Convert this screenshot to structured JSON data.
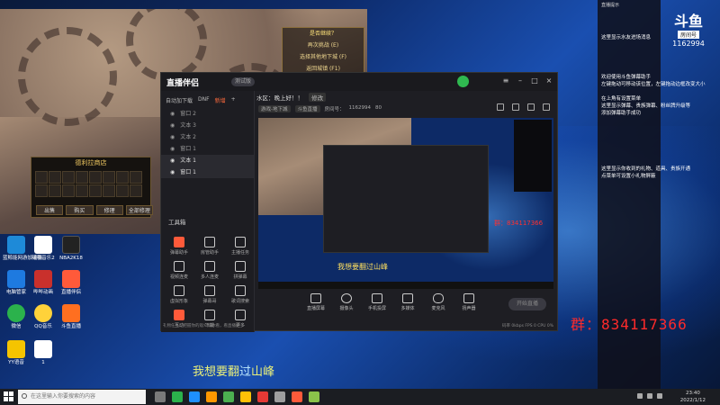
{
  "game": {
    "menu": [
      "是否继续？",
      "再次挑战 (E)",
      "选择其他地下城 (F)",
      "返回城镇 (F1)"
    ],
    "shop_title": "德利拉商店",
    "shop_buttons": [
      "出售",
      "购买",
      "修理",
      "全部修理"
    ]
  },
  "desktop_icons": [
    {
      "label": "蓝鲸能网游加速器",
      "color": "#1e8ad8"
    },
    {
      "label": "咕咕音乐2",
      "color": "#ffffff"
    },
    {
      "label": "NBA2K18",
      "color": "#222222"
    },
    {
      "label": "电脑管家",
      "color": "#1e7ae0"
    },
    {
      "label": "哔哔动画",
      "color": "#c9302c"
    },
    {
      "label": "直播伴侣",
      "color": "#ff5a3a"
    },
    {
      "label": "微信",
      "color": "#2bb24c"
    },
    {
      "label": "QQ音乐",
      "color": "#ffd23a"
    },
    {
      "label": "斗鱼直播",
      "color": "#ff6f20"
    },
    {
      "label": "YY语音",
      "color": "#f5c400"
    },
    {
      "label": "1",
      "color": "#ffffff"
    }
  ],
  "app": {
    "title": "直播伴侣",
    "badge": "测试版",
    "tabs": [
      "自动加下载",
      "DNF",
      "新增"
    ],
    "scenes": [
      "窗口 2",
      "文本 3",
      "文本 2",
      "窗口 1",
      "文本 1",
      "窗口 1"
    ],
    "tools_label": "工具箱",
    "tools": [
      "弹幕助手",
      "房管助手",
      "主播任务",
      "视频连麦",
      "多人连麦",
      "拼弹幕",
      "虚拟形象",
      "弹幕哥",
      "歌词搜索",
      "互动",
      "下载",
      "更多"
    ],
    "room_title": "水区：晚上好！！",
    "edit_label": "修改",
    "sub_tags": [
      "游戏-地下城",
      "斗鱼直播"
    ],
    "room_no_label": "房间号：",
    "room_no": "1162994",
    "fans": "80",
    "controls": [
      "直播屏幕",
      "摄像头",
      "手机投屏",
      "多媒体",
      "麦克风",
      "扬声器"
    ],
    "start_button": "开始直播",
    "status_left": "礼物任务，把握你的观众帮你看，看直播吧",
    "status_right": "码率 0kbps   FPS 0   CPU 0%"
  },
  "preview": {
    "contact": "群：834117366",
    "subtitle": "我想要翻过山峰"
  },
  "douyu": {
    "brand": "斗鱼",
    "room_label": "房间号",
    "room_number": "1162994",
    "panel_title": "直播提示",
    "messages": [
      "这里显示水友进场消息",
      "欢迎使用斗鱼弹幕助手",
      "左键拖动可移动该位置，左键拖动边框改变大小",
      "在上角有设置菜单",
      "这里显示弹幕、贵族弹幕、粉丝牌升级等",
      "添加弹幕助手成功",
      "这里显示你收到的礼物、道具、贵族开通",
      "点菜单可设置小礼物屏蔽"
    ]
  },
  "contact_overlay": "群：834117366",
  "subtitle": {
    "before": "我想要翻",
    "highlight": "过",
    "after": "山峰"
  },
  "taskbar": {
    "search_placeholder": "在这里输入你要搜索的内容",
    "time": "23:40",
    "date": "2022/1/12"
  }
}
